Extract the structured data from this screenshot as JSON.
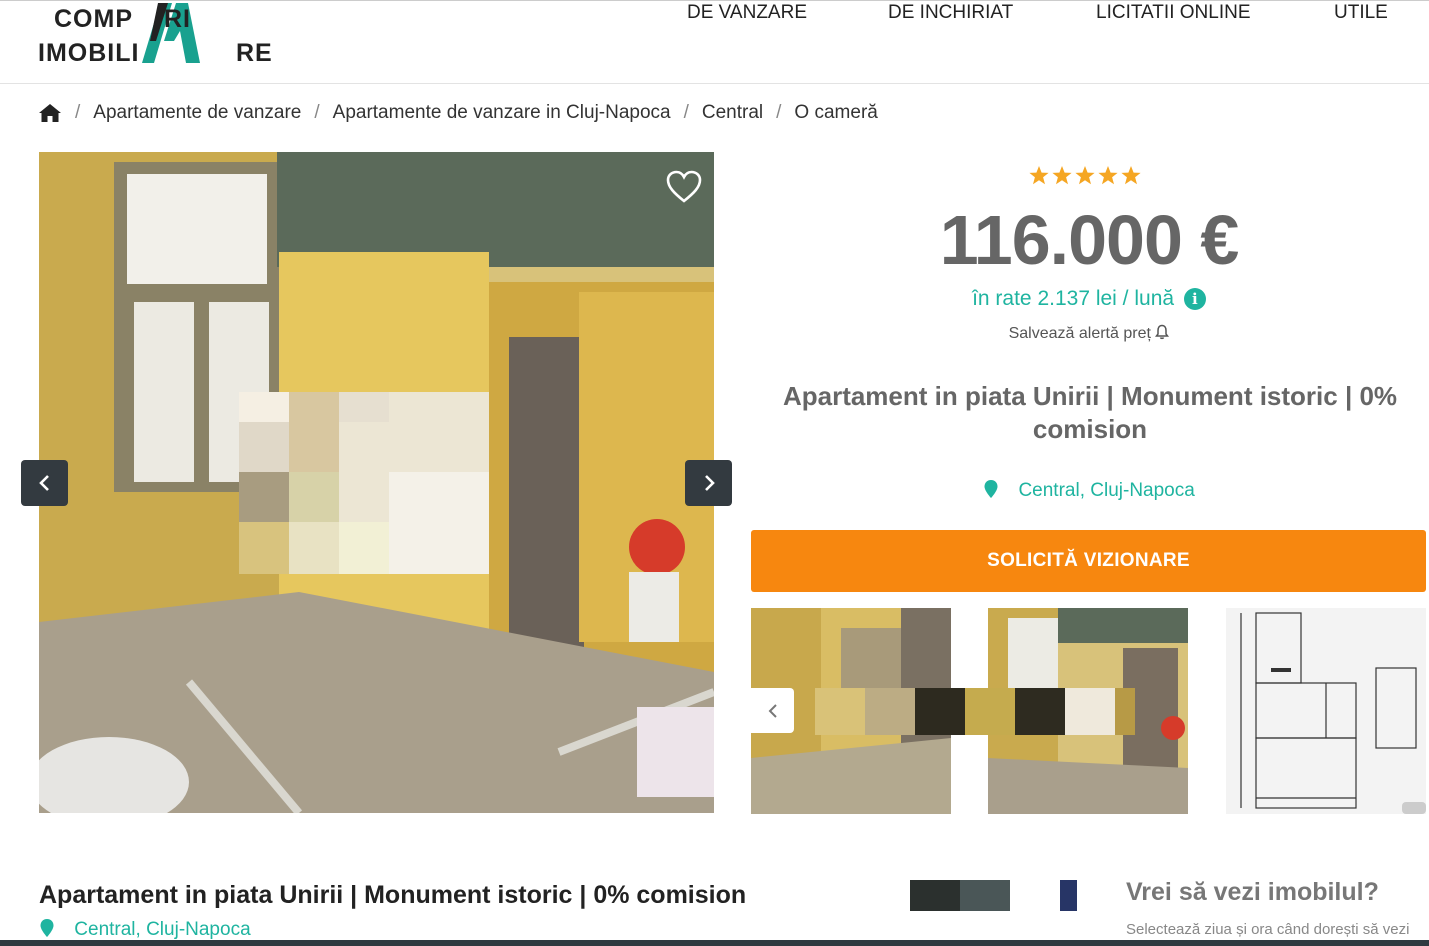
{
  "header": {
    "logo": {
      "line1_left": "COMP",
      "line1_right": "RI",
      "line2_left": "IMOBILI",
      "line2_right": "RE"
    },
    "nav": [
      {
        "label": "DE VANZARE"
      },
      {
        "label": "DE INCHIRIAT"
      },
      {
        "label": "LICITATII ONLINE"
      },
      {
        "label": "UTILE"
      }
    ]
  },
  "breadcrumb": {
    "home_icon": "home-icon",
    "separator": "/",
    "items": [
      {
        "label": "Apartamente de vanzare"
      },
      {
        "label": "Apartamente de vanzare in Cluj-Napoca"
      },
      {
        "label": "Central"
      },
      {
        "label": "O cameră"
      }
    ]
  },
  "listing": {
    "rating_stars": 5,
    "price": "116.000 €",
    "installment": "în rate 2.137 lei / lună",
    "alert_label": "Salvează alertă preț",
    "title": "Apartament in piata Unirii | Monument istoric | 0% comision",
    "location": "Central, Cluj-Napoca",
    "cta_label": "SOLICITĂ VIZIONARE"
  },
  "visit": {
    "title": "Vrei să vezi imobilul?",
    "subtitle": "Selectează ziua și ora când dorești să vezi"
  },
  "colors": {
    "accent_teal": "#1fb4a0",
    "cta_orange": "#f7870f",
    "star_orange": "#f5a623",
    "price_gray": "#666666"
  },
  "icons": [
    "home-icon",
    "heart-icon",
    "chevron-left-icon",
    "chevron-right-icon",
    "info-icon",
    "bell-icon",
    "map-pin-icon",
    "star-icon"
  ]
}
